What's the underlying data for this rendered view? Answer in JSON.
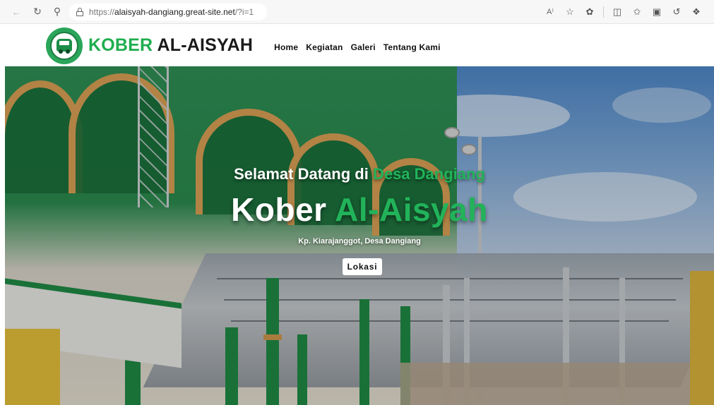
{
  "browser": {
    "url_proto": "https://",
    "url_host": "alaisyah-dangiang.great-site.net",
    "url_rest": "/?i=1",
    "read_aloud": "Ă",
    "icons": [
      "back-icon",
      "reload-icon",
      "search-icon",
      "lock-icon",
      "read-aloud-icon",
      "favorite-star-icon",
      "extensions-icon",
      "split-screen-icon",
      "favorites-icon",
      "collections-icon",
      "history-icon",
      "copilot-icon"
    ]
  },
  "site": {
    "brand_part1": "KOBER",
    "brand_part2": " AL-AISYAH",
    "menu": [
      {
        "label": "Home"
      },
      {
        "label": "Kegiatan"
      },
      {
        "label": "Galeri"
      },
      {
        "label": "Tentang Kami"
      }
    ]
  },
  "hero": {
    "welcome_prefix": "Selamat Datang di ",
    "welcome_accent": "Desa Dangiang",
    "title_prefix": "Kober ",
    "title_accent": "Al-Aisyah",
    "subtitle": "Kp. Kiarajanggot, Desa Dangiang",
    "button_label": "Lokasi"
  },
  "colors": {
    "accent_green": "#22b35a",
    "brand_green": "#1fae4f"
  }
}
